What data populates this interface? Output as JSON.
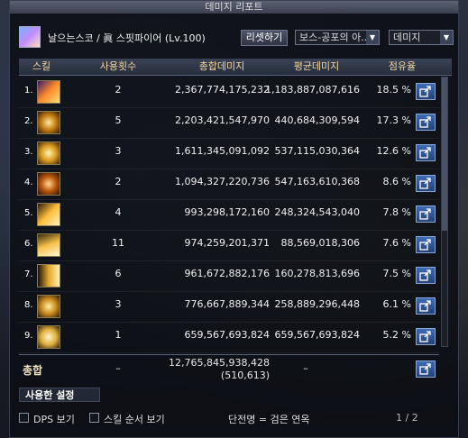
{
  "window": {
    "title": "데미지 리포트"
  },
  "header": {
    "character": "날으는스코 / 眞 스핏파이어 (Lv.100)",
    "reset_label": "리셋하기",
    "boss_filter": "보스-공포의 아..",
    "mode_filter": "데미지"
  },
  "table": {
    "columns": {
      "skill": "스킬",
      "uses": "사용횟수",
      "total": "총합데미지",
      "avg": "평균데미지",
      "share": "점유율"
    },
    "rows": [
      {
        "rank": "1.",
        "uses": "2",
        "total": "2,367,774,175,232",
        "avg": "1,183,887,087,616",
        "share": "18.5 %"
      },
      {
        "rank": "2.",
        "uses": "5",
        "total": "2,203,421,547,970",
        "avg": "440,684,309,594",
        "share": "17.3 %"
      },
      {
        "rank": "3.",
        "uses": "3",
        "total": "1,611,345,091,092",
        "avg": "537,115,030,364",
        "share": "12.6 %"
      },
      {
        "rank": "4.",
        "uses": "2",
        "total": "1,094,327,220,736",
        "avg": "547,163,610,368",
        "share": "8.6 %"
      },
      {
        "rank": "5.",
        "uses": "4",
        "total": "993,298,172,160",
        "avg": "248,324,543,040",
        "share": "7.8 %"
      },
      {
        "rank": "6.",
        "uses": "11",
        "total": "974,259,201,371",
        "avg": "88,569,018,306",
        "share": "7.6 %"
      },
      {
        "rank": "7.",
        "uses": "6",
        "total": "961,672,882,176",
        "avg": "160,278,813,696",
        "share": "7.5 %"
      },
      {
        "rank": "8.",
        "uses": "3",
        "total": "776,667,889,344",
        "avg": "258,889,296,448",
        "share": "6.1 %"
      },
      {
        "rank": "9.",
        "uses": "1",
        "total": "659,567,693,824",
        "avg": "659,567,693,824",
        "share": "5.2 %"
      }
    ],
    "total": {
      "label": "총합",
      "uses": "–",
      "sum": "12,765,845,938,428",
      "count": "(510,613)",
      "avg": "–"
    }
  },
  "usage_tab": "사용한 설정",
  "footer": {
    "dps_label": "DPS 보기",
    "order_label": "스킬 순서 보기",
    "legend": "단전명 = 검은 연옥",
    "page": "1 / 2"
  },
  "colors": {
    "accent": "#f0d7a0",
    "button": "#3f6bb4"
  }
}
